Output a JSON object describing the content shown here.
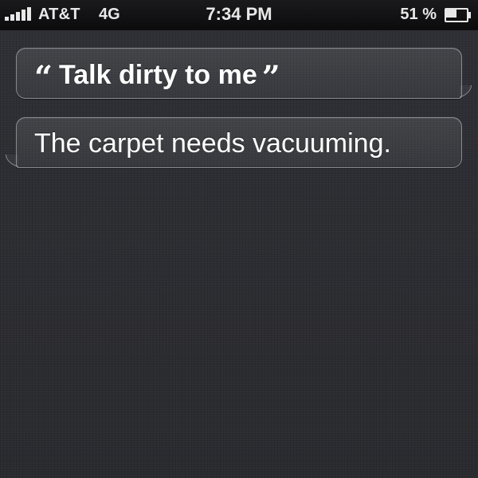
{
  "status_bar": {
    "signal_bars": 5,
    "carrier": "AT&T",
    "network": "4G",
    "time": "7:34 PM",
    "battery_percent_label": "51 %",
    "battery_level": 0.51
  },
  "conversation": {
    "user_query": {
      "open_quote": "“",
      "text": "Talk dirty to me",
      "close_quote": "”"
    },
    "assistant_reply": {
      "text": "The carpet needs vacuuming."
    }
  },
  "icons": {
    "signal": "signal-strength-icon",
    "battery": "battery-icon"
  },
  "colors": {
    "text": "#ffffff",
    "status_bar_bg": "#0b0b0c",
    "background": "#2c2d31"
  }
}
